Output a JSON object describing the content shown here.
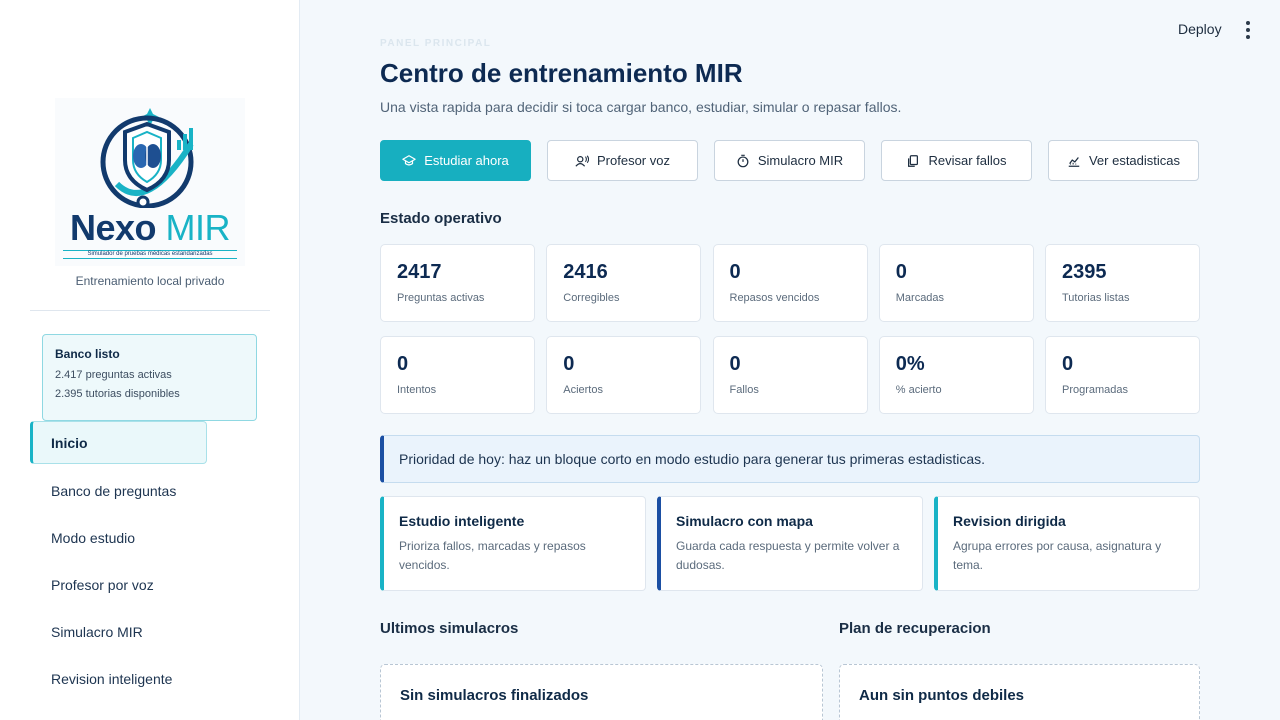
{
  "sidebar": {
    "brand": {
      "name_a": "Nexo",
      "name_b": "MIR",
      "tagline": "Simulador de pruebas médicas estandarizadas"
    },
    "caption": "Entrenamiento local privado",
    "bank_card": {
      "title": "Banco listo",
      "line1": "2.417 preguntas activas",
      "line2": "2.395 tutorias disponibles"
    },
    "nav": [
      {
        "label": "Inicio"
      },
      {
        "label": "Banco de preguntas"
      },
      {
        "label": "Modo estudio"
      },
      {
        "label": "Profesor por voz"
      },
      {
        "label": "Simulacro MIR"
      },
      {
        "label": "Revision inteligente"
      }
    ]
  },
  "topbar": {
    "deploy_label": "Deploy",
    "menu_icon": "kebab-menu-icon"
  },
  "header": {
    "eyebrow": "PANEL PRINCIPAL",
    "title": "Centro de entrenamiento MIR",
    "subtitle": "Una vista rapida para decidir si toca cargar banco, estudiar, simular o repasar fallos."
  },
  "actions": [
    {
      "label": "Estudiar ahora",
      "icon": "graduation-cap-icon"
    },
    {
      "label": "Profesor voz",
      "icon": "voice-user-icon"
    },
    {
      "label": "Simulacro MIR",
      "icon": "stopwatch-icon"
    },
    {
      "label": "Revisar fallos",
      "icon": "copy-pages-icon"
    },
    {
      "label": "Ver estadisticas",
      "icon": "chart-line-icon"
    }
  ],
  "status": {
    "title": "Estado operativo",
    "stats": [
      {
        "value": "2417",
        "label": "Preguntas activas"
      },
      {
        "value": "2416",
        "label": "Corregibles"
      },
      {
        "value": "0",
        "label": "Repasos vencidos"
      },
      {
        "value": "0",
        "label": "Marcadas"
      },
      {
        "value": "2395",
        "label": "Tutorias listas"
      },
      {
        "value": "0",
        "label": "Intentos"
      },
      {
        "value": "0",
        "label": "Aciertos"
      },
      {
        "value": "0",
        "label": "Fallos"
      },
      {
        "value": "0%",
        "label": "% acierto"
      },
      {
        "value": "0",
        "label": "Programadas"
      }
    ]
  },
  "priority": "Prioridad de hoy: haz un bloque corto en modo estudio para generar tus primeras estadisticas.",
  "features": [
    {
      "title": "Estudio inteligente",
      "desc": "Prioriza fallos, marcadas y repasos vencidos."
    },
    {
      "title": "Simulacro con mapa",
      "desc": "Guarda cada respuesta y permite volver a dudosas."
    },
    {
      "title": "Revision dirigida",
      "desc": "Agrupa errores por causa, asignatura y tema."
    }
  ],
  "sections": {
    "simulacros": {
      "title": "Ultimos simulacros",
      "empty": "Sin simulacros finalizados"
    },
    "recovery": {
      "title": "Plan de recuperacion",
      "empty": "Aun sin puntos debiles"
    }
  },
  "colors": {
    "accent": "#17afc0",
    "navy": "#0d2a52",
    "blue": "#1b4fa3",
    "background": "#f3f8fc"
  }
}
